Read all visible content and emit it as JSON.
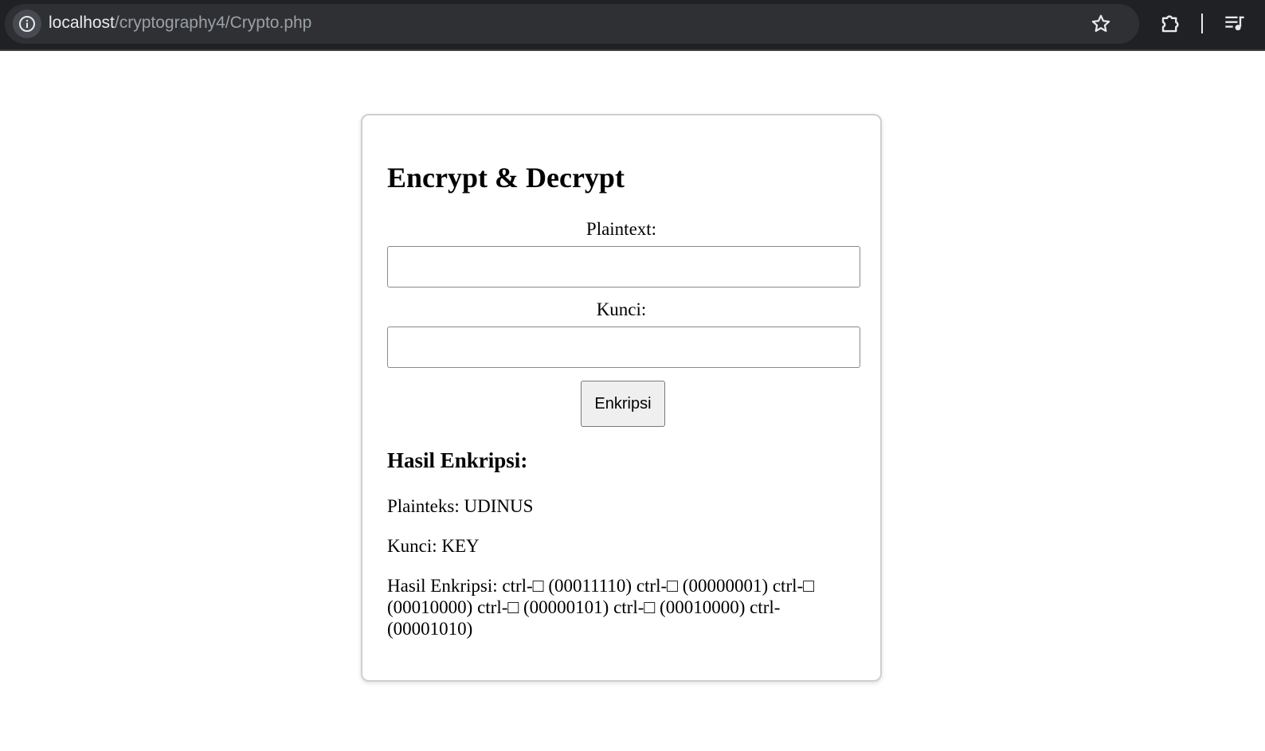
{
  "browser": {
    "url_host": "localhost",
    "url_path": "/cryptography4/Crypto.php",
    "icons": {
      "info": "info-circle-icon",
      "bookmark": "star-icon",
      "extensions": "puzzle-piece-icon",
      "reading_list": "playlist-icon"
    }
  },
  "page": {
    "title": "Encrypt & Decrypt",
    "form": {
      "plaintext_label": "Plaintext:",
      "plaintext_value": "",
      "key_label": "Kunci:",
      "key_value": "",
      "submit_label": "Enkripsi"
    },
    "result": {
      "heading": "Hasil Enkripsi:",
      "plaintext_line": "Plainteks: UDINUS",
      "key_line": "Kunci: KEY",
      "cipher_line": "Hasil Enkripsi: ctrl-□ (00011110) ctrl-□ (00000001) ctrl-□ (00010000) ctrl-□ (00000101) ctrl-□ (00010000) ctrl-(00001010)"
    }
  }
}
